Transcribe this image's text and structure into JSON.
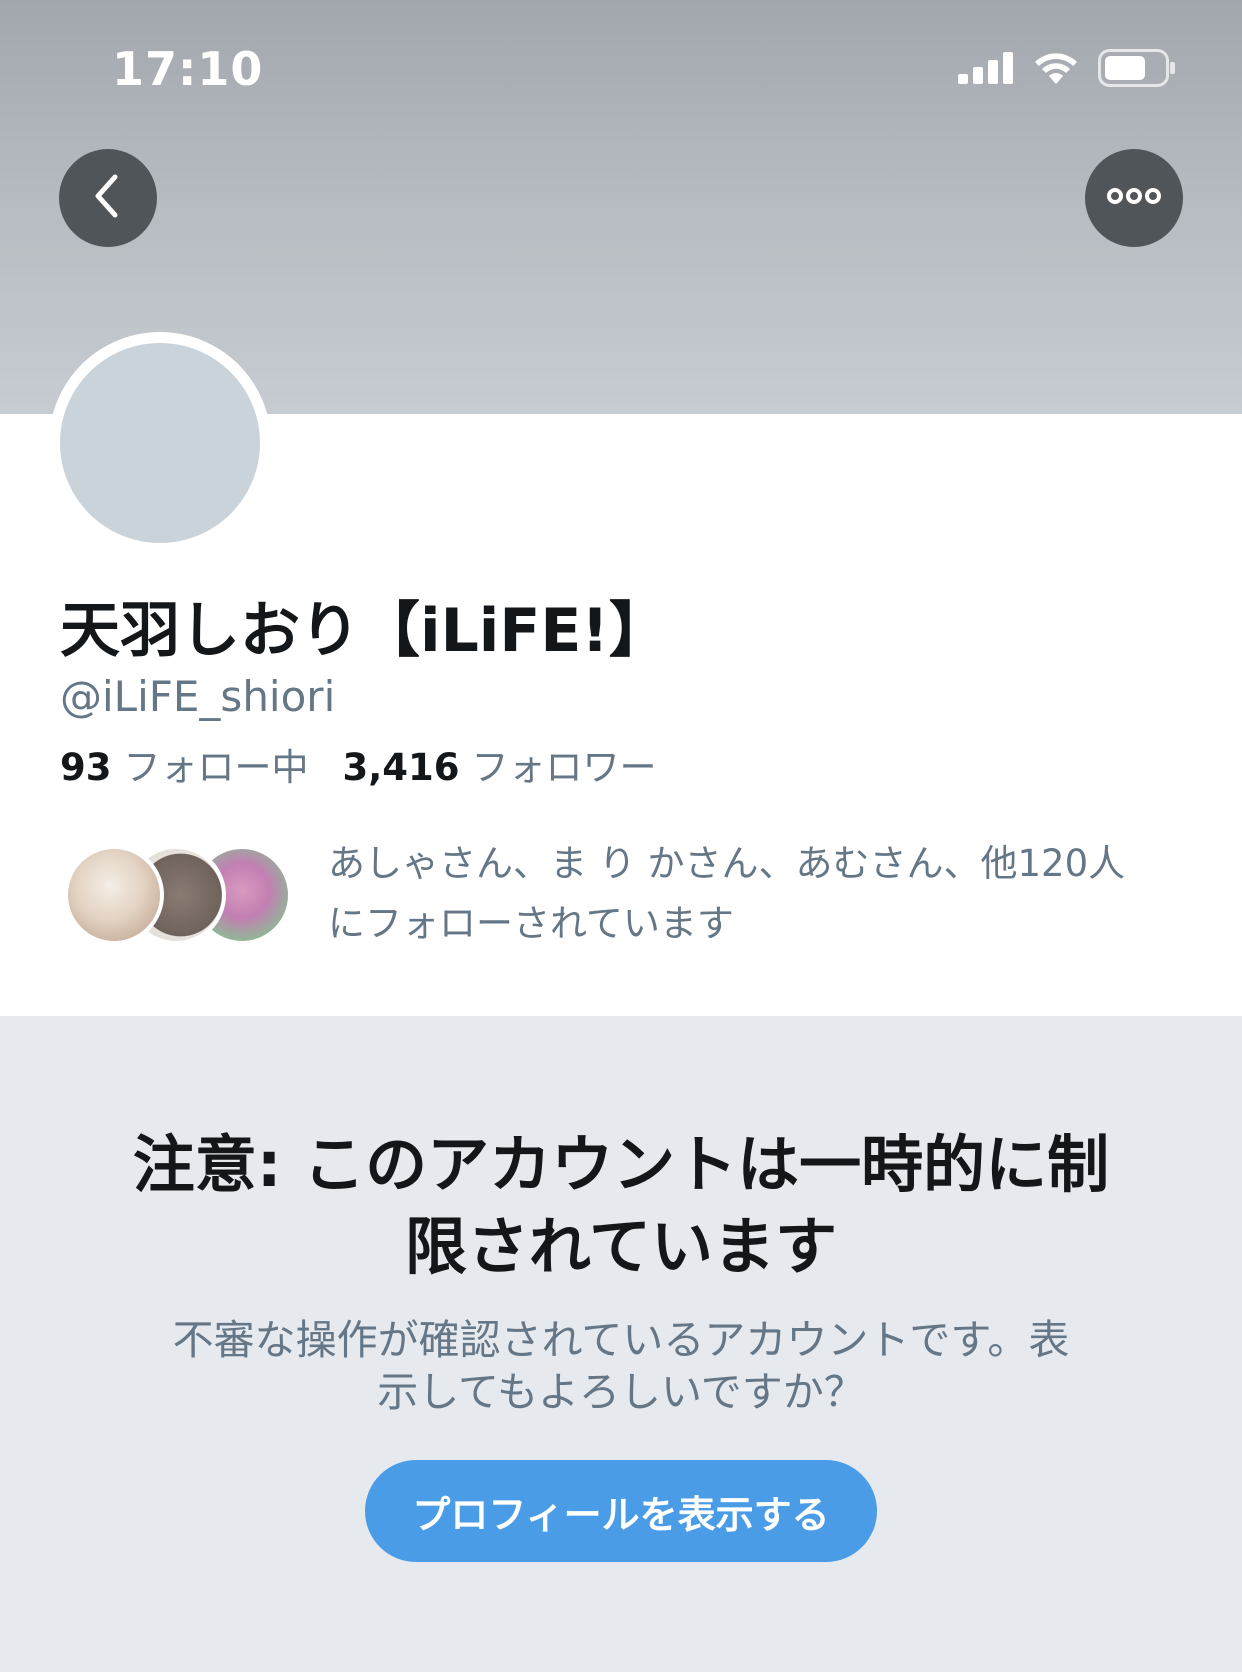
{
  "status_bar": {
    "time": "17:10",
    "icons": [
      "cellular-signal-icon",
      "wifi-icon",
      "battery-icon"
    ]
  },
  "nav": {
    "back_icon": "chevron-left-icon",
    "more_icon": "more-horizontal-icon"
  },
  "profile": {
    "display_name": "天羽しおり【iLiFE!】",
    "handle": "@iLiFE_shiori",
    "following_count": "93",
    "following_label": "フォロー中",
    "followers_count": "3,416",
    "followers_label": "フォロワー",
    "followed_by_line1": "あしゃさん、ま り かさん、あむさん、他120人",
    "followed_by_line2": "にフォローされています"
  },
  "restriction": {
    "title_line1": "注意: このアカウントは一時的に制",
    "title_line2": "限されています",
    "desc_line1": "不審な操作が確認されているアカウントです。表",
    "desc_line2": "示してもよろしいですか？",
    "button_label": "プロフィールを表示する"
  },
  "colors": {
    "accent": "#4a9ce6",
    "secondary_text": "#657786",
    "restricted_bg": "#e6e9ee"
  }
}
